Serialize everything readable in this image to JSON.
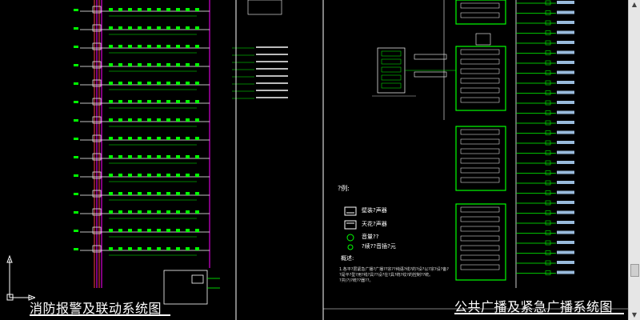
{
  "drawings": {
    "left_title": "消防报警及联动系统图",
    "right_title": "公共广播及紧急广播系统图"
  },
  "legend": {
    "header": "?例:",
    "items": [
      {
        "label": "壁装?声器",
        "icon": "wall-speaker-icon"
      },
      {
        "label": "天花?声器",
        "icon": "ceiling-speaker-icon"
      },
      {
        "label": "音量??",
        "icon": "volume-control-icon"
      },
      {
        "label": "?续??音插?元",
        "icon": "jack-icon"
      }
    ]
  },
  "notes": {
    "header": "概述:",
    "body": "1.各平?层紧急广播?广播??宗??纯语?线?的?设?以?宗?设?备?",
    "body2": "?是平?型?用?线?具??设?在?具?统?纹?的控制??统。",
    "body3": "?共(?)?统??器??。"
  },
  "colors": {
    "background": "#000000",
    "bus_magenta": "#ff00ff",
    "bus_green": "#00ff00",
    "wire_white": "#ffffff",
    "frame_white": "#ffffff"
  }
}
